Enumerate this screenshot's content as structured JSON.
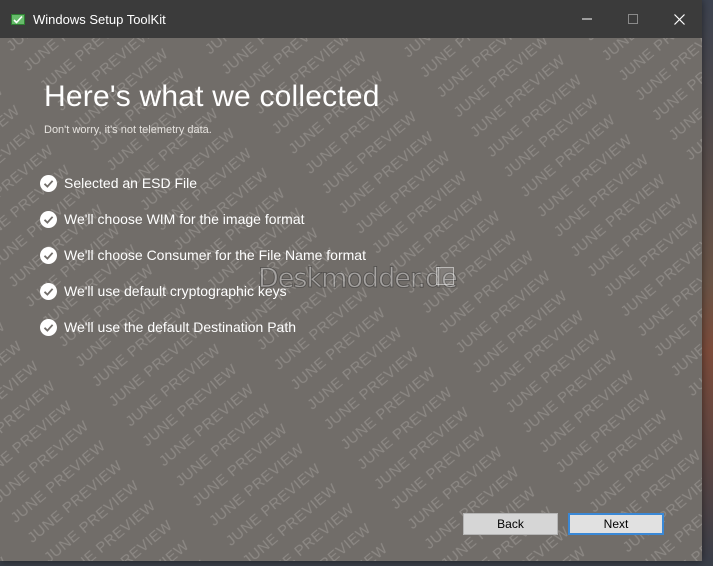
{
  "window": {
    "title": "Windows Setup ToolKit",
    "controls": {
      "minimize": "minimize",
      "maximize": "maximize",
      "close": "close"
    }
  },
  "main": {
    "heading": "Here's what we collected",
    "subheading": "Don't worry, it's not telemetry data.",
    "items": [
      {
        "label": "Selected an ESD File",
        "icon": "check-circle-icon"
      },
      {
        "label": "We'll choose WIM for the image format",
        "icon": "check-circle-icon"
      },
      {
        "label": "We'll choose Consumer for the File Name format",
        "icon": "check-circle-icon"
      },
      {
        "label": "We'll use default cryptographic keys",
        "icon": "check-circle-icon"
      },
      {
        "label": "We'll use the default Destination Path",
        "icon": "check-circle-icon"
      }
    ]
  },
  "watermark": {
    "text": "JUNE PREVIEW",
    "brand": "Deskmodder.de"
  },
  "footer": {
    "back_label": "Back",
    "next_label": "Next"
  },
  "colors": {
    "titlebar": "#3b3b3b",
    "content_bg": "#716d69",
    "accent_focus": "#3a88d6"
  }
}
